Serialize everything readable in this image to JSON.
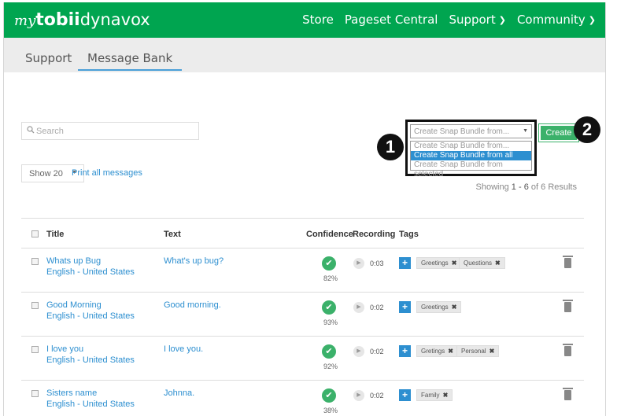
{
  "header": {
    "logo": {
      "my": "my",
      "tobii": "tobii",
      "dynavox": "dynavox"
    },
    "nav": [
      {
        "label": "Store",
        "dropdown": false
      },
      {
        "label": "Pageset Central",
        "dropdown": false
      },
      {
        "label": "Support",
        "dropdown": true
      },
      {
        "label": "Community",
        "dropdown": true
      }
    ]
  },
  "subnav": {
    "tabs": [
      {
        "label": "Support"
      },
      {
        "label": "Message Bank",
        "active": true
      }
    ]
  },
  "search": {
    "placeholder": "Search"
  },
  "show": {
    "value": "Show 20",
    "print_all": "Print all messages"
  },
  "bundle": {
    "selected": "Create Snap Bundle from...",
    "options": [
      "Create Snap Bundle from...",
      "Create Snap Bundle from all",
      "Create Snap Bundle from selected"
    ],
    "highlighted_index": 1,
    "create_label": "Create",
    "callouts": [
      "1",
      "2"
    ]
  },
  "results": {
    "prefix": "Showing",
    "range": "1 - 6",
    "of": "of",
    "total": "6",
    "suffix": "Results"
  },
  "table": {
    "headers": {
      "title": "Title",
      "text": "Text",
      "confidence": "Confidence",
      "recording": "Recording",
      "tags": "Tags"
    },
    "rows": [
      {
        "title": "Whats up Bug",
        "language": "English - United States",
        "text": "What's up bug?",
        "confidence": "82%",
        "duration": "0:03",
        "tags": [
          "Greetings",
          "Questions"
        ]
      },
      {
        "title": "Good Morning",
        "language": "English - United States",
        "text": "Good morning.",
        "confidence": "93%",
        "duration": "0:02",
        "tags": [
          "Greetings"
        ]
      },
      {
        "title": "I love you",
        "language": "English - United States",
        "text": "I love you.",
        "confidence": "92%",
        "duration": "0:02",
        "tags": [
          "Gretings",
          "Personal"
        ]
      },
      {
        "title": "Sisters name",
        "language": "English - United States",
        "text": "Johnna.",
        "confidence": "38%",
        "duration": "0:02",
        "tags": [
          "Family"
        ]
      }
    ]
  },
  "colors": {
    "brand_green": "#00a550",
    "link_blue": "#2d8fd0",
    "check_green": "#3bb16a"
  },
  "icons": {
    "search": "search-icon",
    "confidence": "check-badge-icon",
    "play": "play-icon",
    "trash": "trash-icon",
    "plus": "plus-icon",
    "remove": "close-icon"
  }
}
